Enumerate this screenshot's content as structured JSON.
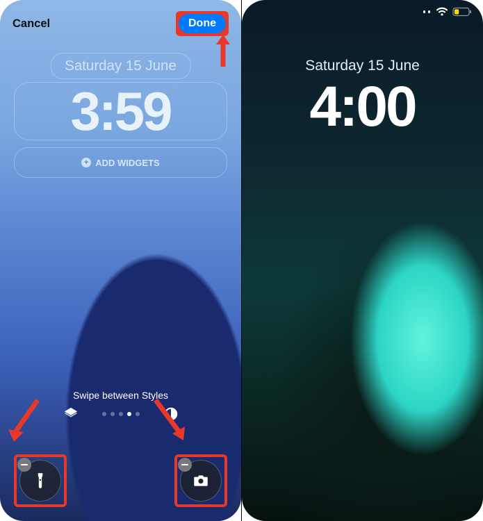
{
  "left": {
    "cancel_label": "Cancel",
    "done_label": "Done",
    "date_text": "Saturday 15 June",
    "clock_text": "3:59",
    "add_widgets_label": "ADD WIDGETS",
    "swipe_label": "Swipe between Styles",
    "page_dots": {
      "count": 5,
      "active_index": 3
    },
    "icons": {
      "layers": "layers-icon",
      "contrast": "contrast-icon",
      "flashlight": "flashlight-icon",
      "camera": "camera-icon"
    },
    "annotations": {
      "done_highlighted": true,
      "flashlight_highlighted": true,
      "camera_highlighted": true,
      "arrows": [
        "to-done",
        "to-flashlight",
        "to-camera"
      ]
    }
  },
  "right": {
    "date_text": "Saturday 15 June",
    "clock_text": "4:00",
    "status": {
      "wifi_icon": "wifi-icon",
      "battery_icon": "battery-low-icon",
      "battery_color": "#ffd60a"
    }
  },
  "colors": {
    "annotation_red": "#e8382a",
    "ios_blue": "#007aff"
  }
}
